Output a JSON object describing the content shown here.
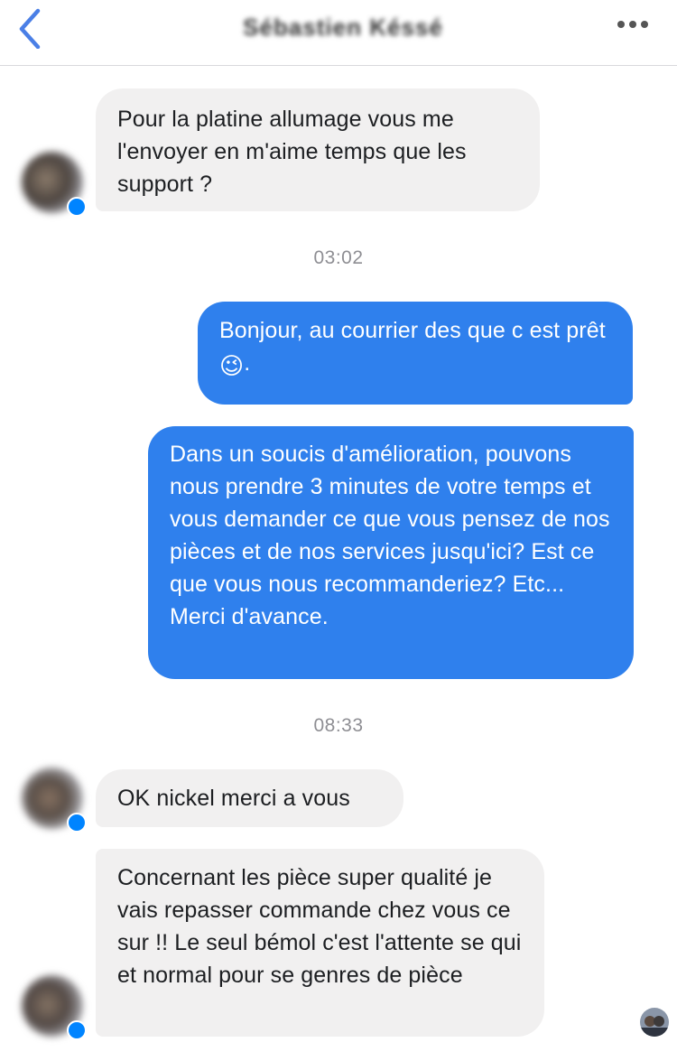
{
  "header": {
    "contact_name": "Sébastien Késsé",
    "back_icon": "chevron-left-icon",
    "more_icon": "more-horizontal-icon",
    "accent": "#4a7fe6"
  },
  "colors": {
    "incoming_bg": "#f1f0f0",
    "outgoing_bg": "#2f80ed",
    "timestamp": "#8e8e93"
  },
  "messages": [
    {
      "from": "contact",
      "text": "Pour la platine allumage vous me l'envoyer en m'aime temps que les support ?"
    },
    {
      "type": "timestamp",
      "text": "03:02"
    },
    {
      "from": "me",
      "text_before_emoji": "Bonjour, au courrier des que c est prêt ",
      "emoji": "😉",
      "text_after_emoji": "."
    },
    {
      "from": "me",
      "text": "Dans un soucis d'amélioration, pouvons nous  prendre 3 minutes de votre temps et vous demander ce que vous pensez de nos pièces et de nos services jusqu'ici? Est ce que vous nous recommanderiez? Etc... Merci d'avance."
    },
    {
      "type": "timestamp",
      "text": "08:33"
    },
    {
      "from": "contact",
      "text": "OK nickel merci a vous"
    },
    {
      "from": "contact",
      "text": "Concernant les pièce super qualité je vais repasser commande chez vous ce sur !! Le seul bémol c'est l'attente se qui et normal pour se genres de pièce"
    }
  ]
}
